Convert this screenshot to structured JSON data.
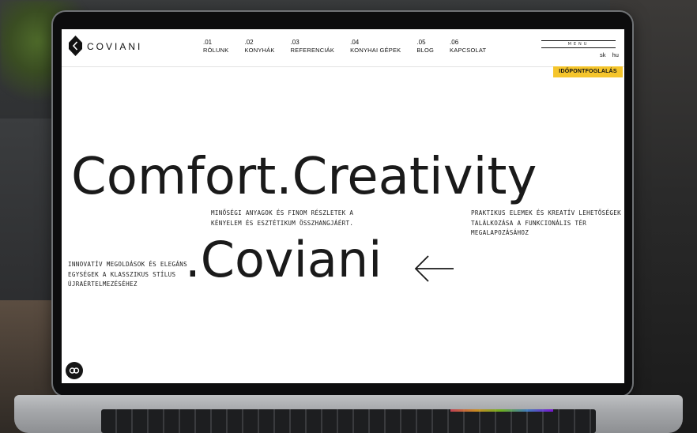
{
  "brand": {
    "name": "COVIANI"
  },
  "nav": [
    {
      "num": ".01",
      "label": "RÓLUNK"
    },
    {
      "num": ".02",
      "label": "KONYHÁK"
    },
    {
      "num": ".03",
      "label": "REFERENCIÁK"
    },
    {
      "num": ".04",
      "label": "KONYHAI GÉPEK"
    },
    {
      "num": ".05",
      "label": "BLOG"
    },
    {
      "num": ".06",
      "label": "KAPCSOLAT"
    }
  ],
  "menu": {
    "label": "MENU"
  },
  "languages": [
    "sk",
    "hu"
  ],
  "booking": {
    "label": "IDŐPONTFOGLALÁS"
  },
  "hero": {
    "title": "Comfort.Creativity",
    "subtitle": ".Coviani",
    "text_left_top": "MINŐSÉGI ANYAGOK ÉS FINOM RÉSZLETEK A KÉNYELEM ÉS ESZTÉTIKUM ÖSSZHANGJÁÉRT.",
    "text_right": "PRAKTIKUS ELEMEK ÉS KREATÍV LEHETŐSÉGEK TALÁLKOZÁSA A FUNKCIONÁLIS TÉR MEGALAPOZÁSÁHOZ",
    "text_left_bottom": "INNOVATÍV MEGOLDÁSOK ÉS ELEGÁNS EGYSÉGEK A KLASSZIKUS STÍLUS ÚJRAÉRTELMEZÉSÉHEZ"
  },
  "colors": {
    "accent": "#f5c52c",
    "text": "#1a1a1a",
    "background": "#ffffff"
  },
  "icons": {
    "logo": "chevron-left-diamond-icon",
    "arrow": "arrow-left-icon",
    "cookie": "cookie-settings-icon"
  }
}
